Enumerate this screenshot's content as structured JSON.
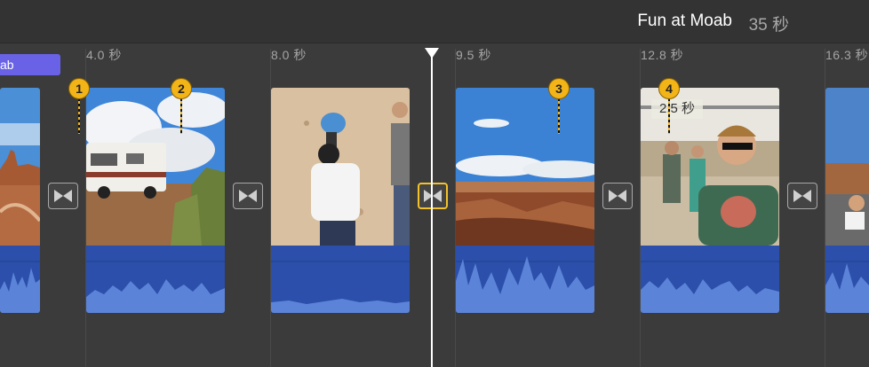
{
  "header": {
    "project_title": "Fun at Moab",
    "project_duration": "35 秒"
  },
  "ruler": {
    "ticks": [
      "4.0 秒",
      "8.0 秒",
      "9.5 秒",
      "12.8 秒",
      "16.3 秒"
    ]
  },
  "title_clip": {
    "label": "ab"
  },
  "markers": [
    "1",
    "2",
    "3",
    "4"
  ],
  "clip_duration_label": "2.5 秒",
  "icons": {
    "transition": "transition-bowtie-icon",
    "playhead": "playhead-icon",
    "marker": "marker-icon"
  },
  "colors": {
    "timeline_bg": "#3b3b3b",
    "audio": "#2b4faa",
    "title_clip": "#6a62e6",
    "marker": "#f2b416",
    "selected_transition": "#f3c22b"
  }
}
